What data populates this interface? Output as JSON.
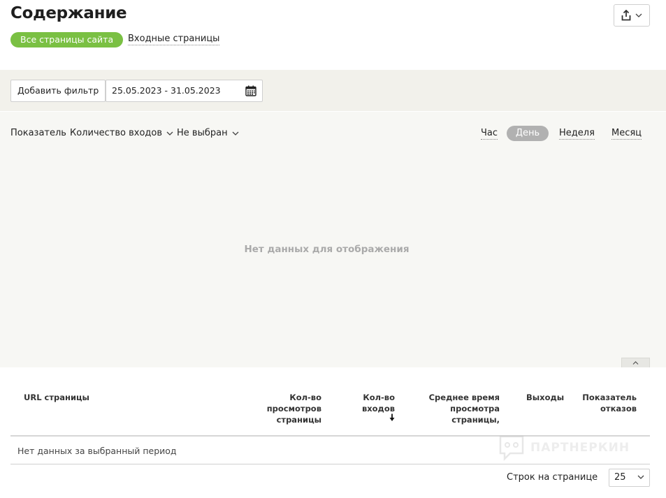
{
  "header": {
    "title": "Содержание"
  },
  "tabs": {
    "all_pages": "Все страницы сайта",
    "entry_pages": "Входные страницы"
  },
  "filters": {
    "add_filter": "Добавить фильтр",
    "date_range": "25.05.2023 - 31.05.2023"
  },
  "chart": {
    "metric_label": "Показатель",
    "metric_dropdown": "Количество входов",
    "second_dropdown": "Не выбран",
    "periods": {
      "hour": "Час",
      "day": "День",
      "week": "Неделя",
      "month": "Месяц"
    },
    "empty_message": "Нет данных для отображения"
  },
  "table": {
    "columns": {
      "url": "URL страницы",
      "views": "Кол-во просмотров страницы",
      "entries": "Кол-во входов",
      "avg_time": "Среднее время просмотра страницы,",
      "exits": "Выходы",
      "bounce": "Показатель отказов"
    },
    "no_data": "Нет данных за выбранный период"
  },
  "watermark": "ПАРТНЕРКИН",
  "pagination": {
    "rows_label": "Строк на странице",
    "rows_value": "25"
  },
  "colors": {
    "accent_green": "#7ac043",
    "period_active": "#b1b1b1"
  }
}
